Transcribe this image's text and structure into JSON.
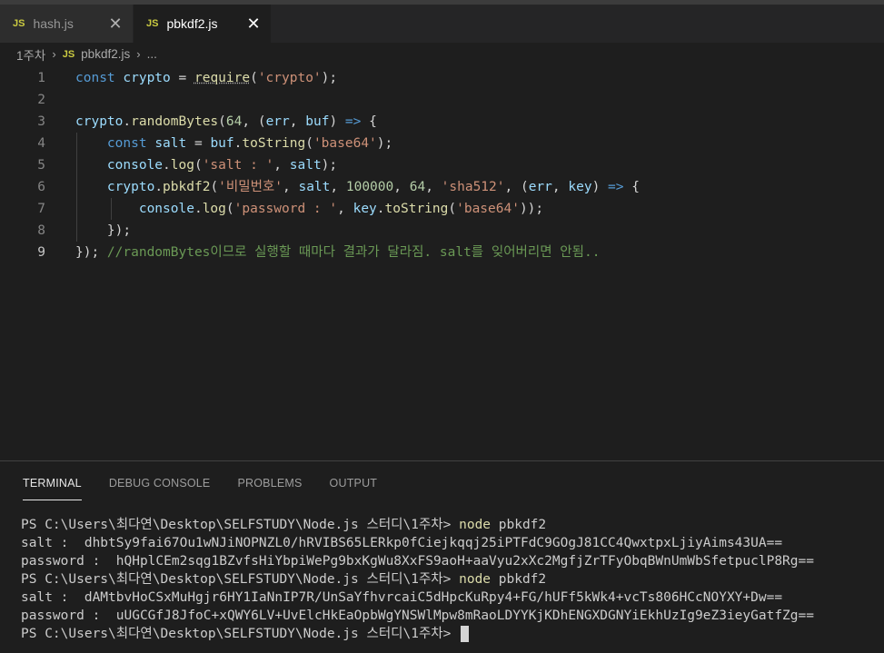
{
  "tabs": [
    {
      "badge": "JS",
      "label": "hash.js",
      "close": "✕"
    },
    {
      "badge": "JS",
      "label": "pbkdf2.js",
      "close": "✕"
    }
  ],
  "breadcrumb": {
    "folder": "1주차",
    "badge": "JS",
    "file": "pbkdf2.js",
    "more": "..."
  },
  "editor": {
    "line_numbers": [
      "1",
      "2",
      "3",
      "4",
      "5",
      "6",
      "7",
      "8",
      "9"
    ],
    "lines": [
      [
        [
          "kw",
          "const"
        ],
        [
          "pun",
          " "
        ],
        [
          "var",
          "crypto"
        ],
        [
          "pun",
          " = "
        ],
        [
          "fn",
          "require"
        ],
        [
          "pun",
          "("
        ],
        [
          "str",
          "'crypto'"
        ],
        [
          "pun",
          ");"
        ]
      ],
      [],
      [
        [
          "var",
          "crypto"
        ],
        [
          "pun",
          "."
        ],
        [
          "fn",
          "randomBytes"
        ],
        [
          "pun",
          "("
        ],
        [
          "num",
          "64"
        ],
        [
          "pun",
          ", ("
        ],
        [
          "var",
          "err"
        ],
        [
          "pun",
          ", "
        ],
        [
          "var",
          "buf"
        ],
        [
          "pun",
          ") "
        ],
        [
          "kw",
          "=>"
        ],
        [
          "pun",
          " {"
        ]
      ],
      [
        [
          "pun",
          "    "
        ],
        [
          "kw",
          "const"
        ],
        [
          "pun",
          " "
        ],
        [
          "var",
          "salt"
        ],
        [
          "pun",
          " = "
        ],
        [
          "var",
          "buf"
        ],
        [
          "pun",
          "."
        ],
        [
          "fn",
          "toString"
        ],
        [
          "pun",
          "("
        ],
        [
          "str",
          "'base64'"
        ],
        [
          "pun",
          ");"
        ]
      ],
      [
        [
          "pun",
          "    "
        ],
        [
          "var",
          "console"
        ],
        [
          "pun",
          "."
        ],
        [
          "fn",
          "log"
        ],
        [
          "pun",
          "("
        ],
        [
          "str",
          "'salt : '"
        ],
        [
          "pun",
          ", "
        ],
        [
          "var",
          "salt"
        ],
        [
          "pun",
          ");"
        ]
      ],
      [
        [
          "pun",
          "    "
        ],
        [
          "var",
          "crypto"
        ],
        [
          "pun",
          "."
        ],
        [
          "fn",
          "pbkdf2"
        ],
        [
          "pun",
          "("
        ],
        [
          "str",
          "'비밀번호'"
        ],
        [
          "pun",
          ", "
        ],
        [
          "var",
          "salt"
        ],
        [
          "pun",
          ", "
        ],
        [
          "num",
          "100000"
        ],
        [
          "pun",
          ", "
        ],
        [
          "num",
          "64"
        ],
        [
          "pun",
          ", "
        ],
        [
          "str",
          "'sha512'"
        ],
        [
          "pun",
          ", ("
        ],
        [
          "var",
          "err"
        ],
        [
          "pun",
          ", "
        ],
        [
          "var",
          "key"
        ],
        [
          "pun",
          ") "
        ],
        [
          "kw",
          "=>"
        ],
        [
          "pun",
          " {"
        ]
      ],
      [
        [
          "pun",
          "        "
        ],
        [
          "var",
          "console"
        ],
        [
          "pun",
          "."
        ],
        [
          "fn",
          "log"
        ],
        [
          "pun",
          "("
        ],
        [
          "str",
          "'password : '"
        ],
        [
          "pun",
          ", "
        ],
        [
          "var",
          "key"
        ],
        [
          "pun",
          "."
        ],
        [
          "fn",
          "toString"
        ],
        [
          "pun",
          "("
        ],
        [
          "str",
          "'base64'"
        ],
        [
          "pun",
          "));"
        ]
      ],
      [
        [
          "pun",
          "    });"
        ]
      ],
      [
        [
          "pun",
          "}); "
        ],
        [
          "cmt",
          "//randomBytes이므로 실행할 때마다 결과가 달라짐. salt를 잊어버리면 안됨.."
        ]
      ]
    ]
  },
  "panel": {
    "tabs": [
      "TERMINAL",
      "DEBUG CONSOLE",
      "PROBLEMS",
      "OUTPUT"
    ],
    "active_tab": "TERMINAL",
    "terminal_lines": [
      {
        "prompt": "PS C:\\Users\\최다연\\Desktop\\SELFSTUDY\\Node.js 스터디\\1주차> ",
        "cmd": "node",
        "args": " pbkdf2"
      },
      {
        "text": "salt :  dhbtSy9fai67Ou1wNJiNOPNZL0/hRVIBS65LERkp0fCiejkqqj25iPTFdC9GOgJ81CC4QwxtpxLjiyAims43UA=="
      },
      {
        "text": "password :  hQHplCEm2sqg1BZvfsHiYbpiWePg9bxKgWu8XxFS9aoH+aaVyu2xXc2MgfjZrTFyObqBWnUmWbSfetpuclP8Rg=="
      },
      {
        "prompt": "PS C:\\Users\\최다연\\Desktop\\SELFSTUDY\\Node.js 스터디\\1주차> ",
        "cmd": "node",
        "args": " pbkdf2"
      },
      {
        "text": "salt :  dAMtbvHoCSxMuHgjr6HY1IaNnIP7R/UnSaYfhvrcaiC5dHpcKuRpy4+FG/hUFf5kWk4+vcTs806HCcNOYXY+Dw=="
      },
      {
        "text": "password :  uUGCGfJ8JfoC+xQWY6LV+UvElcHkEaOpbWgYNSWlMpw8mRaoLDYYKjKDhENGXDGNYiEkhUzIg9eZ3ieyGatfZg=="
      },
      {
        "prompt": "PS C:\\Users\\최다연\\Desktop\\SELFSTUDY\\Node.js 스터디\\1주차> ",
        "cursor": true
      }
    ]
  }
}
